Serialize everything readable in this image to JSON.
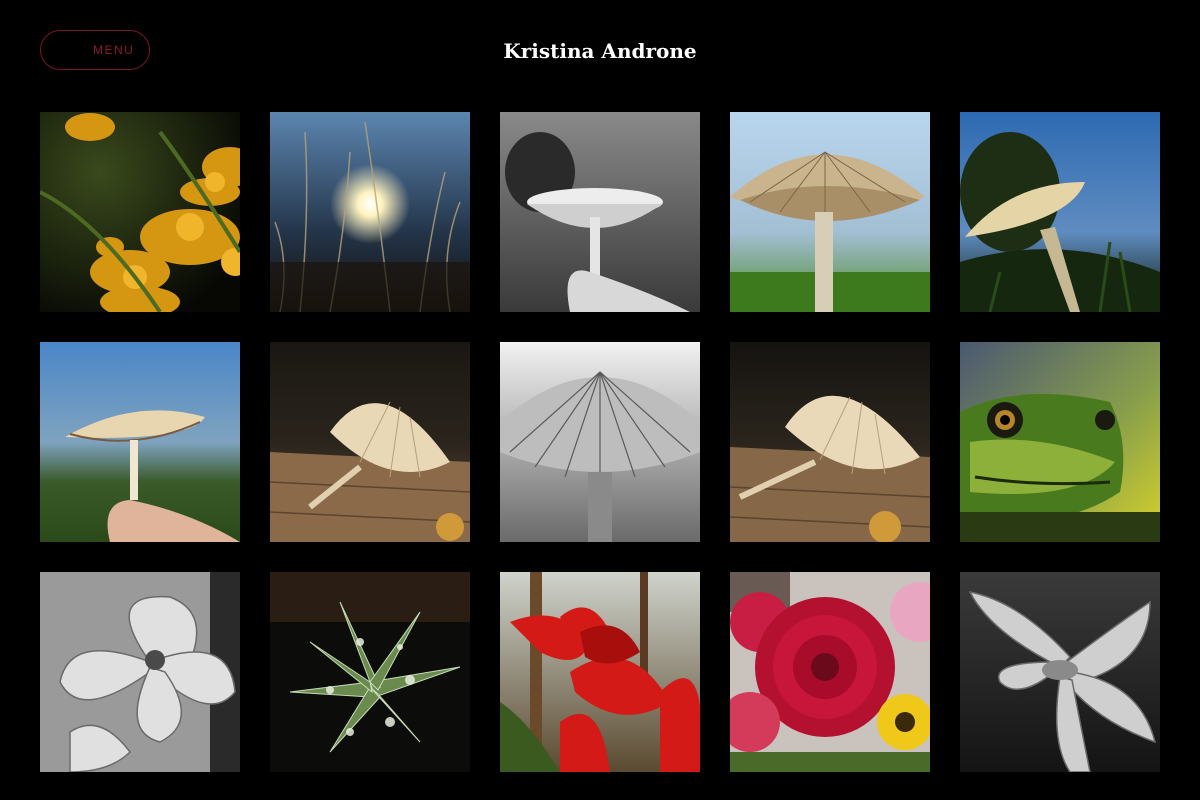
{
  "header": {
    "menu_label": "MENU",
    "title": "Kristina Androne"
  },
  "gallery": {
    "photos": [
      {
        "subject": "goldenrod flowers"
      },
      {
        "subject": "sunlit grass"
      },
      {
        "subject": "mushroom black and white"
      },
      {
        "subject": "mushroom from below"
      },
      {
        "subject": "mushroom against sky"
      },
      {
        "subject": "mushroom held in fingers"
      },
      {
        "subject": "mushroom on wood"
      },
      {
        "subject": "mushroom gills black and white"
      },
      {
        "subject": "mushroom on wood"
      },
      {
        "subject": "green frog"
      },
      {
        "subject": "gladiolus black and white"
      },
      {
        "subject": "succulent with water drops"
      },
      {
        "subject": "red gladiolus"
      },
      {
        "subject": "red dahlia"
      },
      {
        "subject": "flower black and white"
      }
    ]
  }
}
